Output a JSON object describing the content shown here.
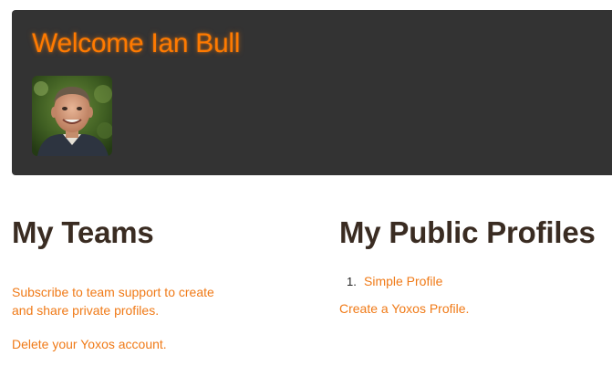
{
  "header": {
    "welcome_text": "Welcome Ian Bull",
    "accent_color": "#ff7a00",
    "panel_color": "#333333"
  },
  "avatar": {
    "alt": "Ian Bull profile photo"
  },
  "teams": {
    "title": "My Teams",
    "subscribe_text": "Subscribe to team support to create and share private profiles.",
    "delete_text": "Delete your Yoxos account."
  },
  "profiles": {
    "title": "My Public Profiles",
    "items": [
      {
        "number": "1.",
        "label": "Simple Profile"
      }
    ],
    "create_text": "Create a Yoxos Profile."
  },
  "colors": {
    "link": "#f07a17",
    "heading": "#3a2c22"
  }
}
